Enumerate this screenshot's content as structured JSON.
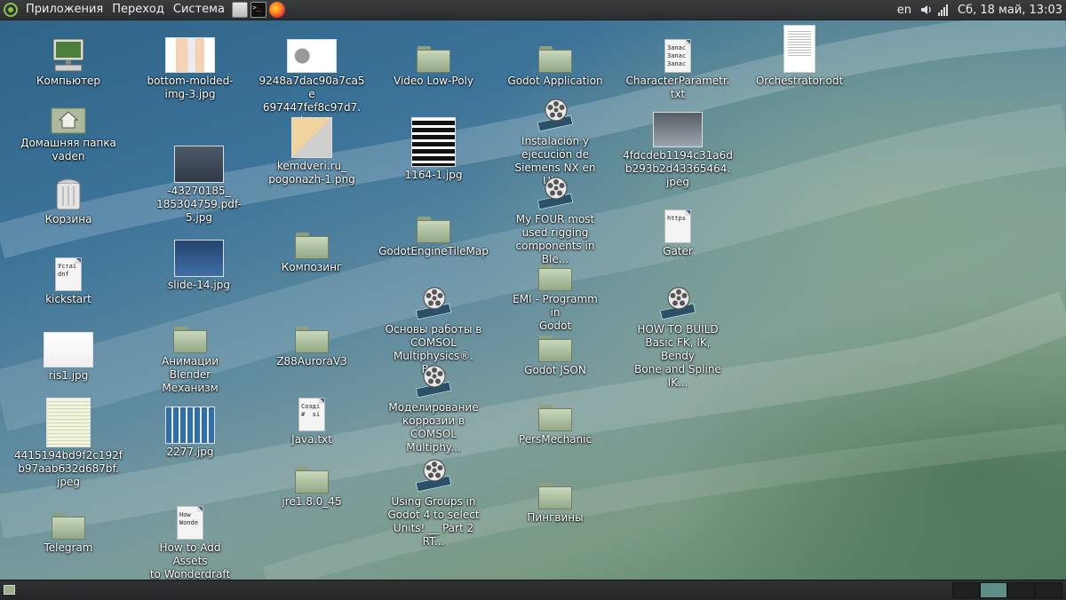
{
  "top_panel": {
    "menus": [
      "Приложения",
      "Переход",
      "Система"
    ],
    "keyboard_layout": "en",
    "clock": "Сб, 18 май, 13:03"
  },
  "desktop": {
    "icons": [
      {
        "id": "computer",
        "label": "Компьютер",
        "kind": "computer",
        "icon": "computer-icon"
      },
      {
        "id": "home",
        "label": "Домашняя папка\nvaden",
        "kind": "home",
        "icon": "home-folder-icon"
      },
      {
        "id": "trash",
        "label": "Корзина",
        "kind": "trash",
        "icon": "trash-icon"
      },
      {
        "id": "kickstart",
        "label": "kickstart",
        "kind": "text",
        "preview": "Устаі\ndnf",
        "icon": "text-file-icon"
      },
      {
        "id": "ris1",
        "label": "ris1.jpg",
        "kind": "image",
        "icon": "image-file-icon"
      },
      {
        "id": "img4415",
        "label": "4415194bd9f2c192f\nb97aab632d687bf.\njpeg",
        "kind": "image",
        "icon": "image-file-icon"
      },
      {
        "id": "telegram",
        "label": "Telegram",
        "kind": "folder",
        "icon": "folder-icon"
      },
      {
        "id": "bottom-molded",
        "label": "bottom-molded-\nimg-3.jpg",
        "kind": "image",
        "icon": "image-file-icon"
      },
      {
        "id": "pdf5",
        "label": "-43270185_\n185304759.pdf-5.jpg",
        "kind": "image",
        "icon": "image-file-icon"
      },
      {
        "id": "slide14",
        "label": "slide-14.jpg",
        "kind": "image",
        "icon": "image-file-icon"
      },
      {
        "id": "anim-blender",
        "label": "Анимации Blender\nМеханизм",
        "kind": "folder",
        "icon": "folder-icon"
      },
      {
        "id": "img2277",
        "label": "2277.jpg",
        "kind": "image",
        "icon": "image-file-icon"
      },
      {
        "id": "wonderdraft",
        "label": "How to Add Assets\nto Wonderdraft",
        "kind": "text",
        "preview": "How\nWonde",
        "icon": "text-file-icon"
      },
      {
        "id": "img9248",
        "label": "9248a7dac90a7ca5e\n697447fef8c97d7.\njpeg",
        "kind": "image",
        "icon": "image-file-icon"
      },
      {
        "id": "kemdveri",
        "label": "kemdveri.ru_\npogonazh-1.png",
        "kind": "image",
        "icon": "image-file-icon"
      },
      {
        "id": "kompozing",
        "label": "Композинг",
        "kind": "folder",
        "icon": "folder-icon"
      },
      {
        "id": "z88",
        "label": "Z88AuroraV3",
        "kind": "folder",
        "icon": "folder-icon"
      },
      {
        "id": "java",
        "label": "Java.txt",
        "kind": "text",
        "preview": "Созді\n#  si",
        "icon": "text-file-icon"
      },
      {
        "id": "jre",
        "label": "jre1.8.0_45",
        "kind": "folder",
        "icon": "folder-icon"
      },
      {
        "id": "video-lowpoly",
        "label": "Video Low-Poly",
        "kind": "folder",
        "icon": "folder-icon"
      },
      {
        "id": "img1164",
        "label": "1164-1.jpg",
        "kind": "image",
        "icon": "image-file-icon"
      },
      {
        "id": "godot-tilemap",
        "label": "GodotEngineTileMap",
        "kind": "folder",
        "icon": "folder-icon"
      },
      {
        "id": "comsol1",
        "label": "Основы работы в\nCOMSOL\nMultiphysics®. Ве...",
        "kind": "video",
        "icon": "video-file-icon"
      },
      {
        "id": "comsol2",
        "label": "Моделирование\nкоррозии в\nCOMSOL Multiphy...",
        "kind": "video",
        "icon": "video-file-icon"
      },
      {
        "id": "godot-groups",
        "label": "Using Groups in\nGodot 4 to select\nUnits! __ Part 2 RT...",
        "kind": "video",
        "icon": "video-file-icon"
      },
      {
        "id": "godot-app",
        "label": "Godot Application",
        "kind": "folder",
        "icon": "folder-icon"
      },
      {
        "id": "siemens",
        "label": "Instalación y\nejecución de\nSiemens NX en Ub...",
        "kind": "video",
        "icon": "video-file-icon"
      },
      {
        "id": "rigging",
        "label": "My FOUR most\nused rigging\ncomponents in Ble...",
        "kind": "video",
        "icon": "video-file-icon"
      },
      {
        "id": "emi",
        "label": "EMI - Programm in\nGodot",
        "kind": "folder",
        "icon": "folder-icon"
      },
      {
        "id": "godot-json",
        "label": "Godot JSON",
        "kind": "folder",
        "icon": "folder-icon"
      },
      {
        "id": "persmechanic",
        "label": "PersMechanic",
        "kind": "folder",
        "icon": "folder-icon"
      },
      {
        "id": "penguins",
        "label": "Пингвины",
        "kind": "folder",
        "icon": "folder-icon"
      },
      {
        "id": "charparam",
        "label": "CharacterParametr.\ntxt",
        "kind": "text",
        "preview": "Запас\nЗапас\nЗапас",
        "icon": "text-file-icon"
      },
      {
        "id": "img4fdc",
        "label": "4fdcdeb1194c31a6d\nb293b2d43365464.\njpeg",
        "kind": "image",
        "icon": "image-file-icon"
      },
      {
        "id": "gater",
        "label": "Gater",
        "kind": "text",
        "preview": "https",
        "icon": "text-file-icon"
      },
      {
        "id": "howtobuild",
        "label": "HOW TO BUILD\nBasic FK, IK, Bendy\nBone and Spline IK...",
        "kind": "video",
        "icon": "video-file-icon"
      },
      {
        "id": "orchestrator",
        "label": "Orchestrator.odt",
        "kind": "odt",
        "icon": "document-file-icon"
      }
    ]
  }
}
